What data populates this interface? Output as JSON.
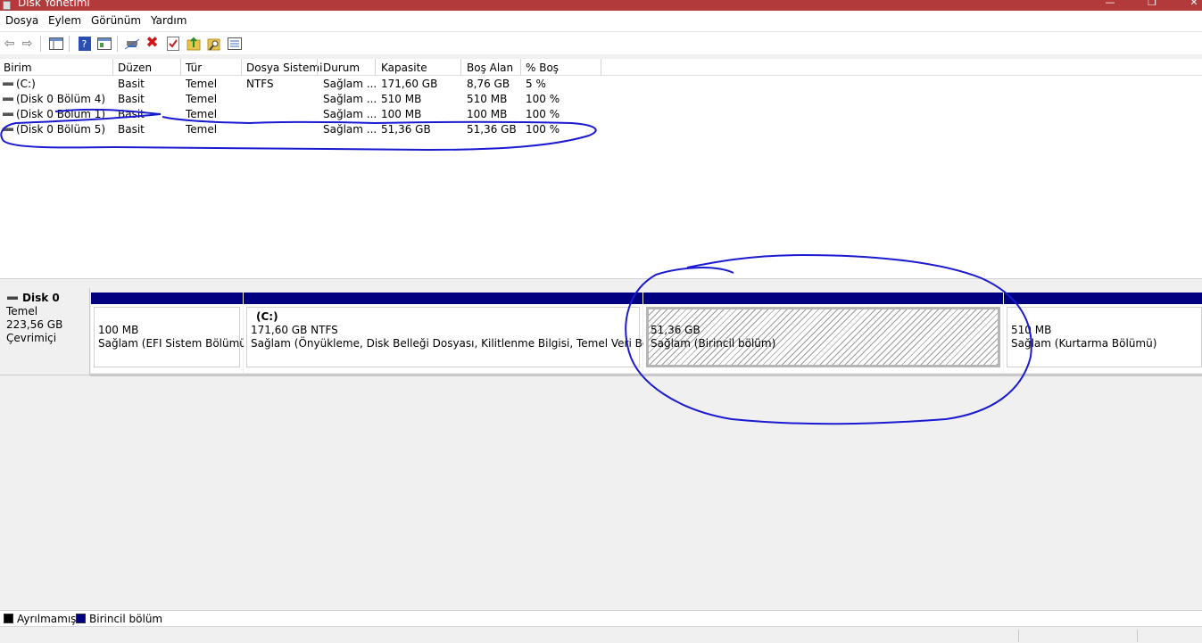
{
  "window": {
    "title": "Disk Yönetimi",
    "accent": "#b33a3a"
  },
  "menu": [
    "Dosya",
    "Eylem",
    "Görünüm",
    "Yardım"
  ],
  "toolbar": {
    "icons": [
      "back-arrow-icon",
      "forward-arrow-icon",
      "console-tree-icon",
      "help-icon",
      "properties-icon",
      "connect-icon",
      "delete-icon",
      "check-icon",
      "up-folder-icon",
      "search-folder-icon",
      "list-icon"
    ]
  },
  "volumes": {
    "columns": [
      "Birim",
      "Düzen",
      "Tür",
      "Dosya Sistemi",
      "Durum",
      "Kapasite",
      "Boş Alan",
      "% Boş"
    ],
    "rows": [
      [
        "(C:)",
        "Basit",
        "Temel",
        "NTFS",
        "Sağlam ...",
        "171,60 GB",
        "8,76 GB",
        "5 %"
      ],
      [
        "(Disk 0 Bölüm 4)",
        "Basit",
        "Temel",
        "",
        "Sağlam ...",
        "510 MB",
        "510 MB",
        "100 %"
      ],
      [
        "(Disk 0 Bölüm 1)",
        "Basit",
        "Temel",
        "",
        "Sağlam ...",
        "100 MB",
        "100 MB",
        "100 %"
      ],
      [
        "(Disk 0 Bölüm 5)",
        "Basit",
        "Temel",
        "",
        "Sağlam ...",
        "51,36 GB",
        "51,36 GB",
        "100 %"
      ]
    ]
  },
  "disk": {
    "name": "Disk 0",
    "type": "Temel",
    "size": "223,56 GB",
    "status": "Çevrimiçi",
    "partitions": [
      {
        "label": "",
        "size": "100 MB",
        "status": "Sağlam (EFI Sistem Bölümü)"
      },
      {
        "label": "(C:)",
        "size": "171,60 GB NTFS",
        "status": "Sağlam (Önyükleme, Disk Belleği Dosyası, Kilitlenme Bilgisi, Temel Veri Bölümü)"
      },
      {
        "label": "",
        "size": "51,36 GB",
        "status": "Sağlam (Birincil bölüm)"
      },
      {
        "label": "",
        "size": "510 MB",
        "status": "Sağlam (Kurtarma Bölümü)"
      }
    ]
  },
  "legend": [
    {
      "label": "Ayrılmamış",
      "color": "#000000"
    },
    {
      "label": "Birincil bölüm",
      "color": "#000080"
    }
  ],
  "annotation_color": "#1a1ad0"
}
